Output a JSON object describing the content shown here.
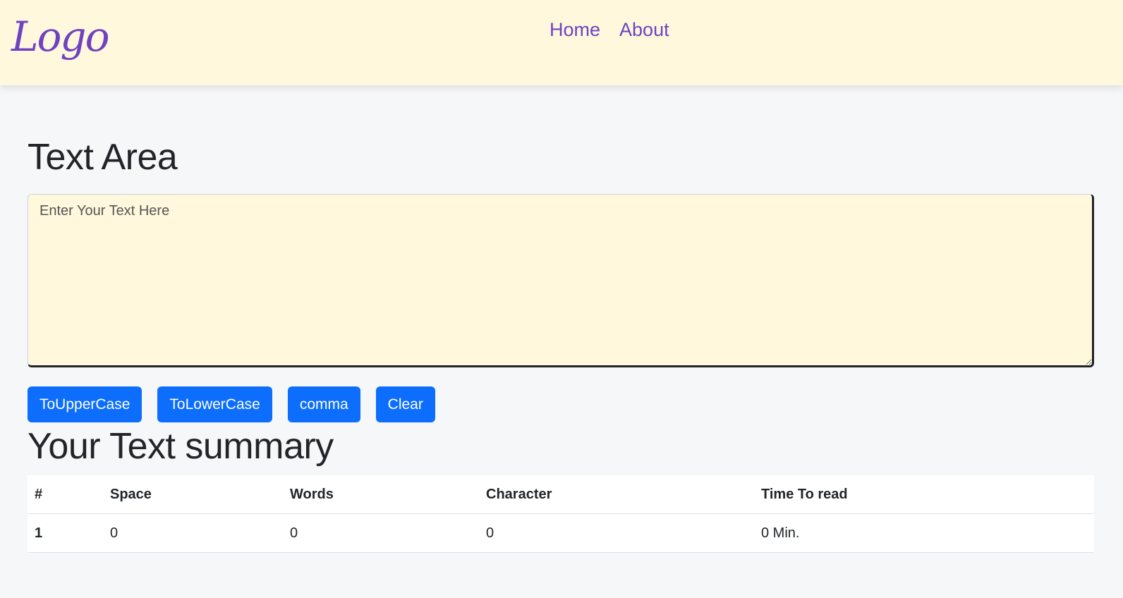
{
  "navbar": {
    "logo": "Logo",
    "links": [
      "Home",
      "About"
    ]
  },
  "main": {
    "heading": "Text Area",
    "textarea": {
      "value": "",
      "placeholder": "Enter Your Text Here"
    },
    "buttons": [
      "ToUpperCase",
      "ToLowerCase",
      "comma",
      "Clear"
    ],
    "summary_heading": "Your Text summary",
    "table": {
      "headers": [
        "#",
        "Space",
        "Words",
        "Character",
        "Time To read"
      ],
      "rows": [
        [
          "1",
          "0",
          "0",
          "0",
          "0 Min."
        ]
      ]
    }
  },
  "colors": {
    "navbar_bg": "#fff8dc",
    "accent": "#6f42c1",
    "button": "#0d6efd",
    "page_bg": "#f6f7f9"
  }
}
